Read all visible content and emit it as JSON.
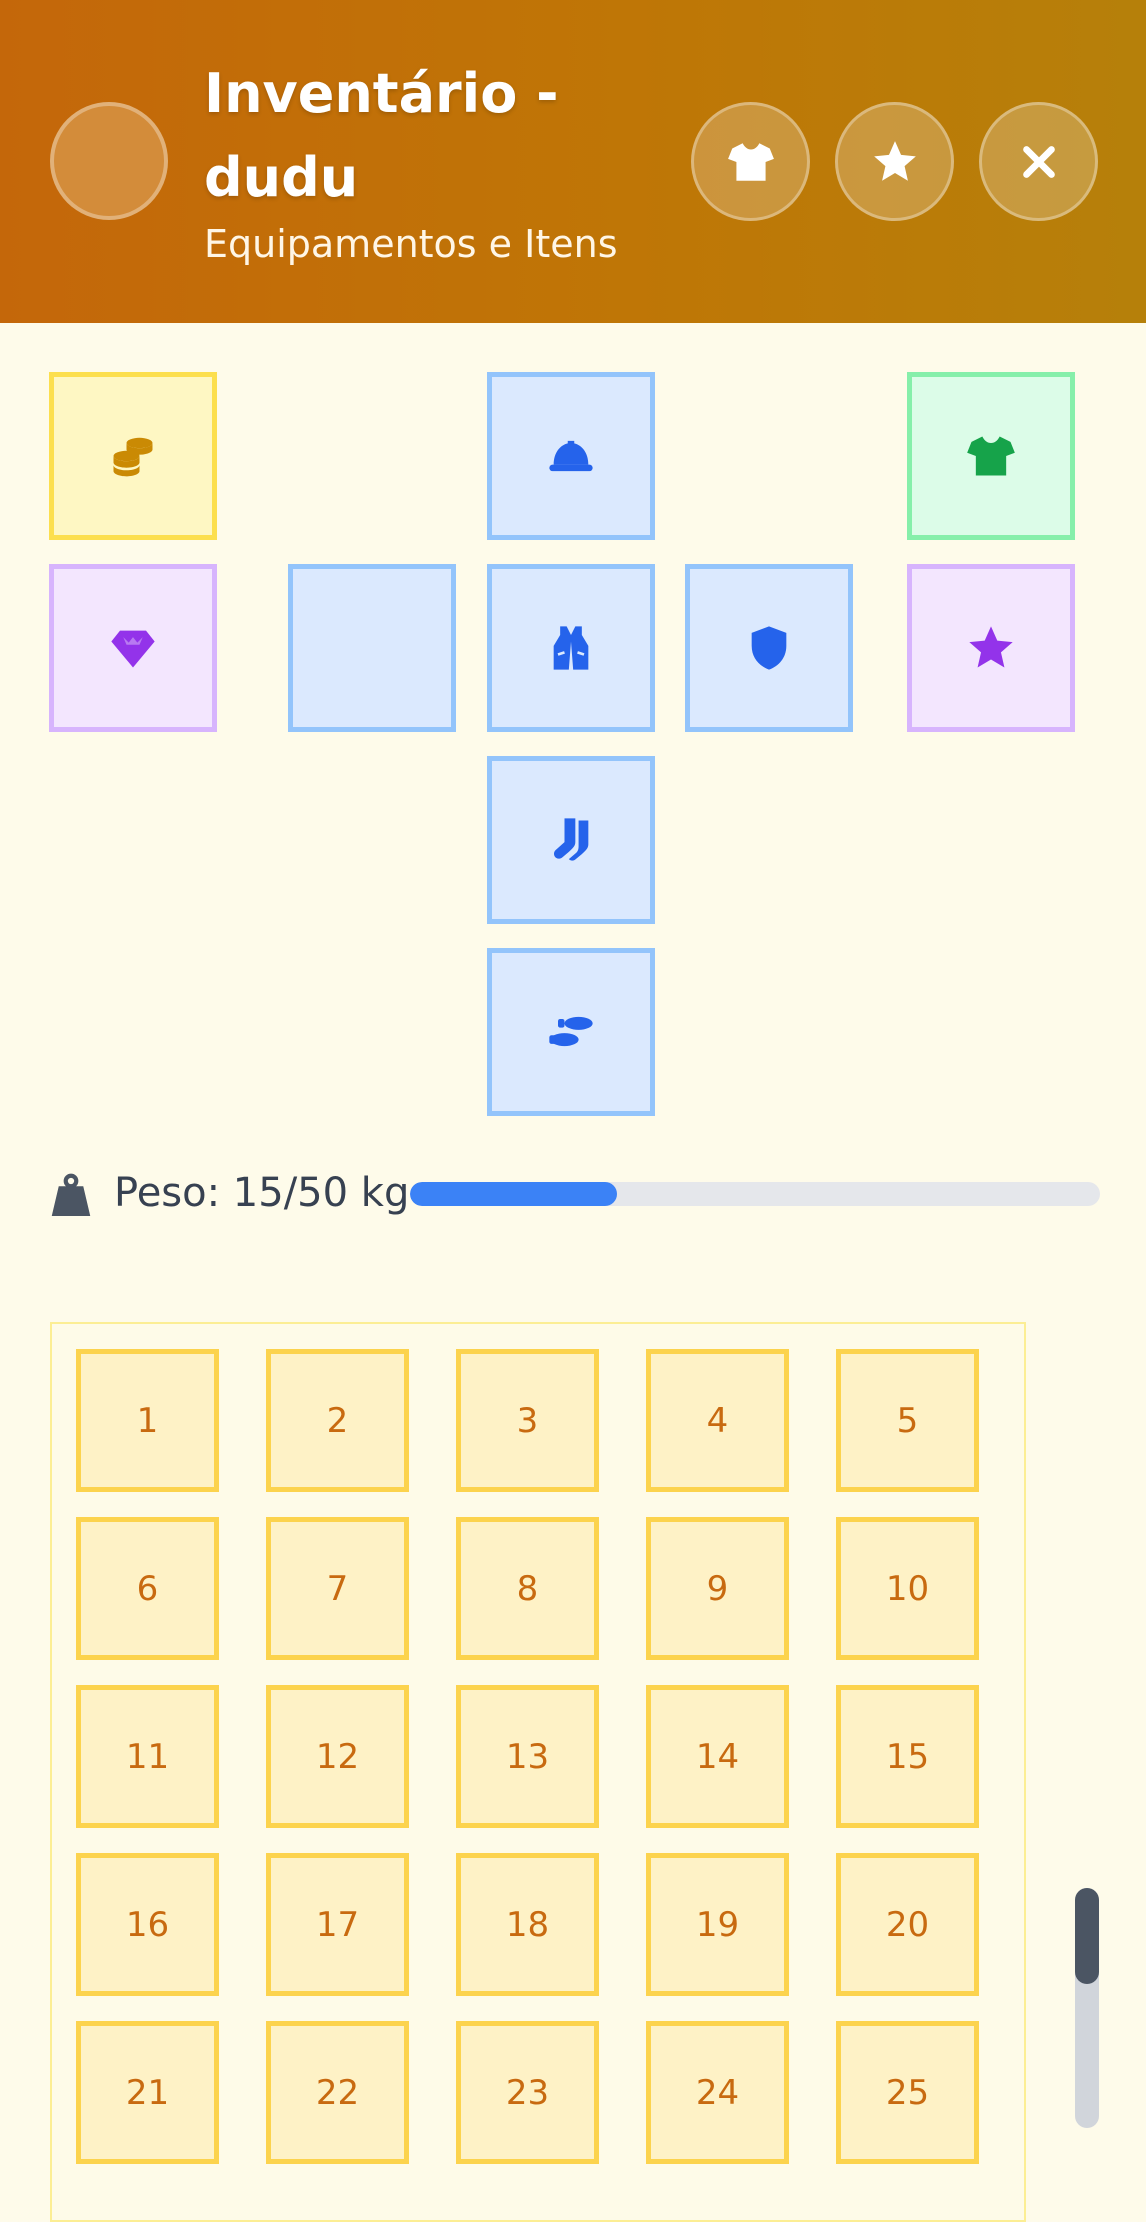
{
  "header": {
    "title": "Inventário - dudu",
    "subtitle": "Equipamentos e Itens",
    "buttons": [
      {
        "name": "outfit-button",
        "icon": "tshirt-icon"
      },
      {
        "name": "favorites-button",
        "icon": "star-icon"
      },
      {
        "name": "close-button",
        "icon": "close-icon"
      }
    ]
  },
  "equipment": {
    "slots": [
      {
        "name": "money-slot",
        "icon": "coins-icon",
        "color": "#ca8a04"
      },
      {
        "name": "helmet-slot",
        "icon": "hard-hat-icon",
        "color": "#2563eb"
      },
      {
        "name": "shirt-slot",
        "icon": "tshirt-icon",
        "color": "#16a34a"
      },
      {
        "name": "gem-slot",
        "icon": "gem-icon",
        "color": "#9333ea"
      },
      {
        "name": "left-hand-slot",
        "icon": "",
        "color": "#2563eb"
      },
      {
        "name": "vest-slot",
        "icon": "vest-icon",
        "color": "#2563eb"
      },
      {
        "name": "shield-slot",
        "icon": "shield-icon",
        "color": "#2563eb"
      },
      {
        "name": "special-slot",
        "icon": "star-icon",
        "color": "#9333ea"
      },
      {
        "name": "socks-slot",
        "icon": "socks-icon",
        "color": "#2563eb"
      },
      {
        "name": "shoes-slot",
        "icon": "shoe-prints-icon",
        "color": "#2563eb"
      }
    ]
  },
  "weight": {
    "label": "Peso: 15/50 kg",
    "current": 15,
    "max": 50,
    "fill_fraction": 0.3,
    "bar_color": "#3b82f6"
  },
  "inventory": {
    "slots": [
      "1",
      "2",
      "3",
      "4",
      "5",
      "6",
      "7",
      "8",
      "9",
      "10",
      "11",
      "12",
      "13",
      "14",
      "15",
      "16",
      "17",
      "18",
      "19",
      "20",
      "21",
      "22",
      "23",
      "24",
      "25"
    ]
  }
}
